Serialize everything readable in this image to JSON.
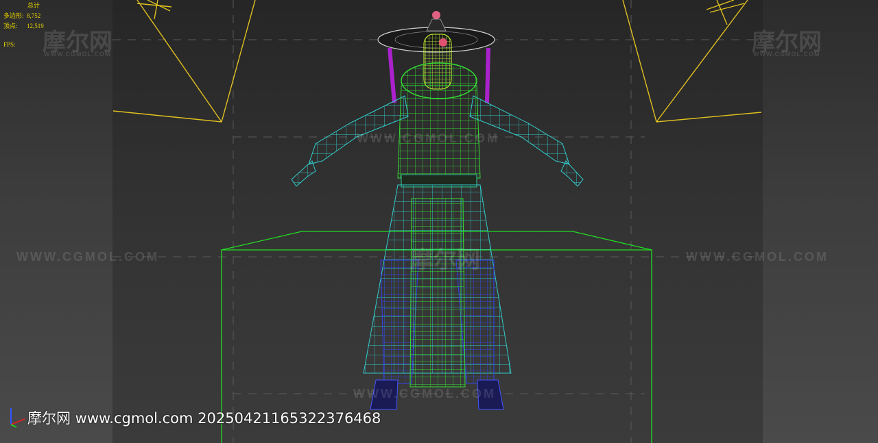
{
  "stats": {
    "title": "总计",
    "polys_label": "多边形:",
    "polys_value": "8,752",
    "verts_label": "顶点:",
    "verts_value": "12,519",
    "fps_label": "FPS:"
  },
  "watermarks": {
    "logo": "摩尔网",
    "site_upper": "WWW.CGMOL.COM"
  },
  "caption": "摩尔网 www.cgmol.com 20250421165322376468",
  "colors": {
    "stats_text": "#e6d200",
    "light_lines": "#e0c020",
    "bbox": "#22dd22",
    "mesh_green": "#33dd33",
    "mesh_cyan": "#33cccc",
    "mesh_blue": "#3344ee",
    "mesh_magenta": "#aa22cc",
    "mesh_lime": "#ccff33"
  }
}
